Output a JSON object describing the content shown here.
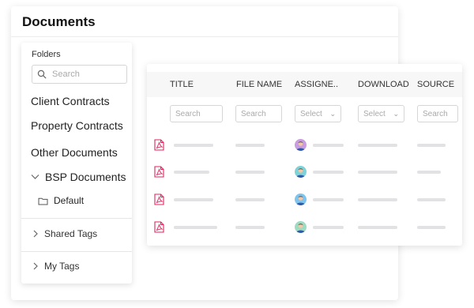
{
  "page": {
    "title": "Documents"
  },
  "sidebar": {
    "folders_label": "Folders",
    "search_placeholder": "Search",
    "items": [
      "Client Contracts",
      "Property Contracts",
      "Other Documents"
    ],
    "bsp": {
      "label": "BSP Documents",
      "expanded": true,
      "children": [
        "Default"
      ]
    },
    "collapsibles": [
      "Shared Tags",
      "My Tags"
    ]
  },
  "table": {
    "columns": [
      "TITLE",
      "FILE NAME",
      "ASSIGNE..",
      "DOWNLOAD",
      "SOURCE"
    ],
    "filters": [
      {
        "type": "input",
        "placeholder": "Search"
      },
      {
        "type": "input",
        "placeholder": "Search"
      },
      {
        "type": "select",
        "placeholder": "Select"
      },
      {
        "type": "select",
        "placeholder": "Select"
      },
      {
        "type": "input",
        "placeholder": "Search"
      }
    ],
    "rows": [
      {
        "file_icon": "pdf-icon",
        "avatar_color": "#c99be0"
      },
      {
        "file_icon": "pdf-icon",
        "avatar_color": "#7fd3d8"
      },
      {
        "file_icon": "pdf-icon",
        "avatar_color": "#7ec4ee"
      },
      {
        "file_icon": "pdf-icon",
        "avatar_color": "#9edbc0"
      }
    ]
  },
  "colors": {
    "pdf": "#e0245e",
    "placeholder_bar": "#e2e2e4",
    "header_band": "#f7f7f8"
  }
}
